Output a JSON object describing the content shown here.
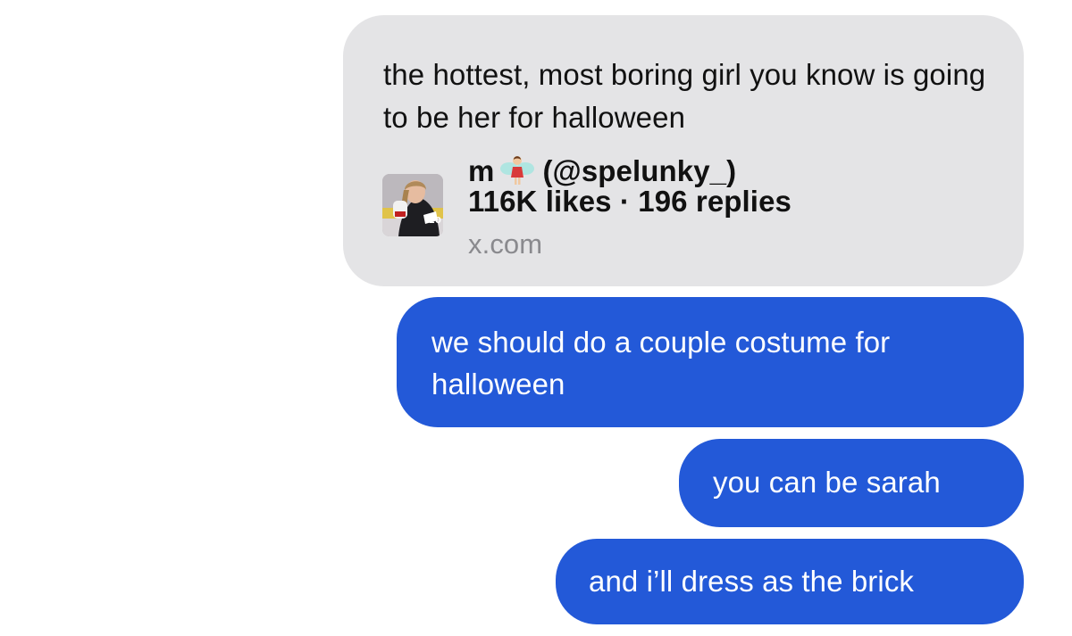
{
  "messages": [
    {
      "direction": "received",
      "text": "the hottest, most boring girl you know is going to be her for halloween",
      "link_preview": {
        "author_name": "m",
        "author_emoji": "fairy-emoji",
        "handle": "(@spelunky_)",
        "stats": "116K likes · 196 replies",
        "domain": "x.com",
        "thumbnail": "hockey-player-photo"
      }
    },
    {
      "direction": "sent",
      "text": "we should do a couple costume for halloween"
    },
    {
      "direction": "sent",
      "text": "you can be sarah"
    },
    {
      "direction": "sent",
      "text": "and i’ll dress as the brick"
    }
  ],
  "colors": {
    "received_bubble": "#e4e4e6",
    "sent_bubble": "#2359d8",
    "received_text": "#111111",
    "sent_text": "#ffffff",
    "domain_text": "#8a8a8e"
  }
}
